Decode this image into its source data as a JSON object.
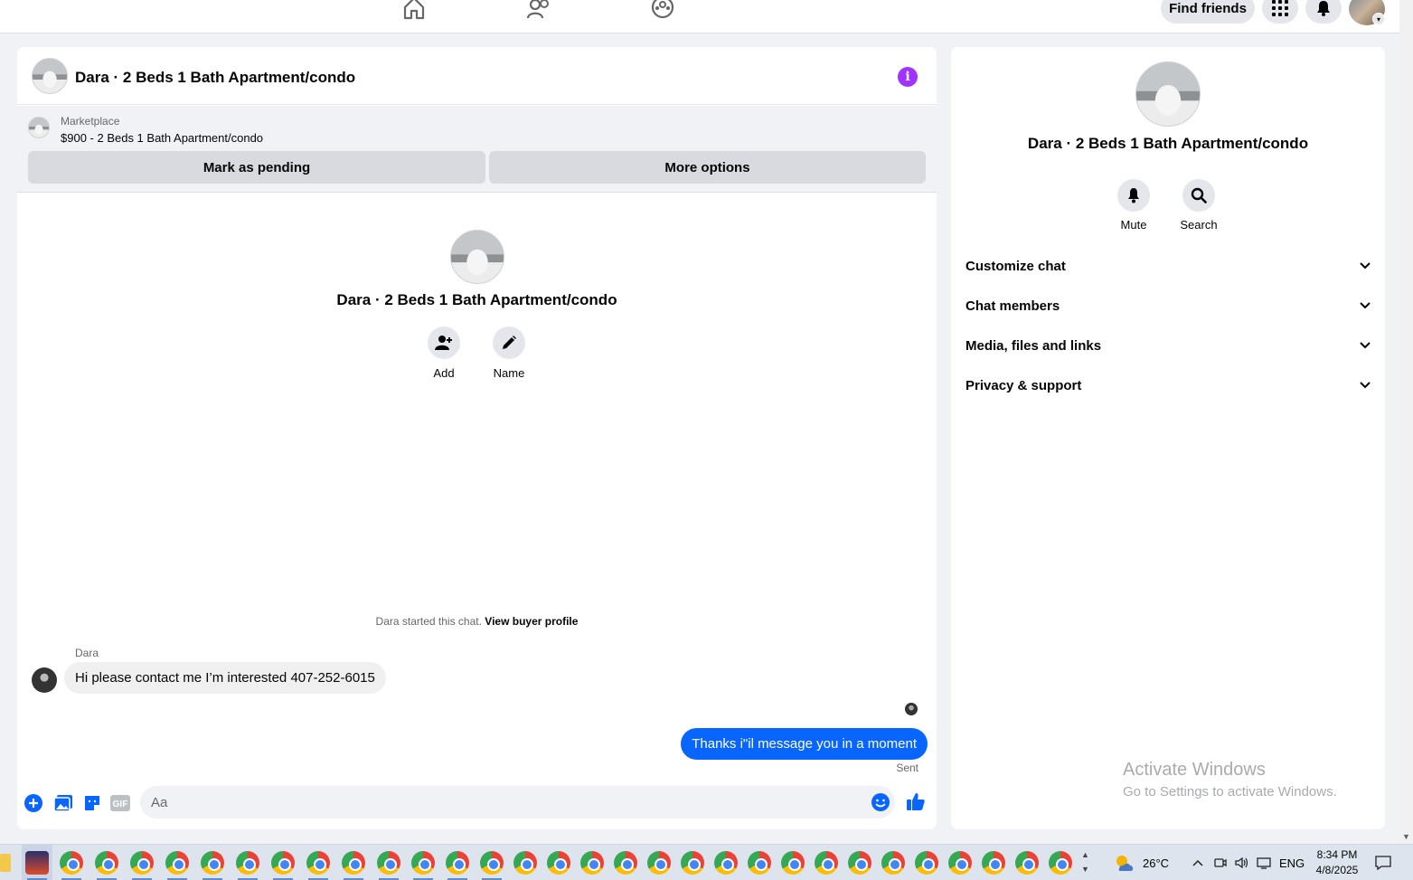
{
  "topnav": {
    "find_friends": "Find friends",
    "icons": [
      "home-icon",
      "friends-icon",
      "groups-icon"
    ]
  },
  "chat": {
    "title": "Dara · 2 Beds 1 Bath Apartment/condo",
    "marketplace_label": "Marketplace",
    "listing": "$900 - 2 Beds 1 Bath Apartment/condo",
    "mark_pending": "Mark as pending",
    "more_options": "More options",
    "center_title": "Dara · 2 Beds 1 Bath Apartment/condo",
    "add_label": "Add",
    "name_label": "Name",
    "started_text": "Dara started this chat.",
    "view_buyer": "View buyer profile",
    "sender": "Dara",
    "incoming_message": "Hi please contact me I’m interested 407-252-6015",
    "outgoing_message": "Thanks i\"il message you in a moment",
    "sent_status": "Sent",
    "input_placeholder": "Aa"
  },
  "side": {
    "title": "Dara · 2 Beds 1 Bath Apartment/condo",
    "mute": "Mute",
    "search": "Search",
    "sections": [
      "Customize chat",
      "Chat members",
      "Media, files and links",
      "Privacy & support"
    ],
    "watermark_title": "Activate Windows",
    "watermark_sub": "Go to Settings to activate Windows."
  },
  "taskbar": {
    "temperature": "26°C",
    "language": "ENG",
    "time": "8:34 PM",
    "date": "4/8/2025"
  },
  "colors": {
    "accent": "#0866ff",
    "info": "#a033ff"
  }
}
